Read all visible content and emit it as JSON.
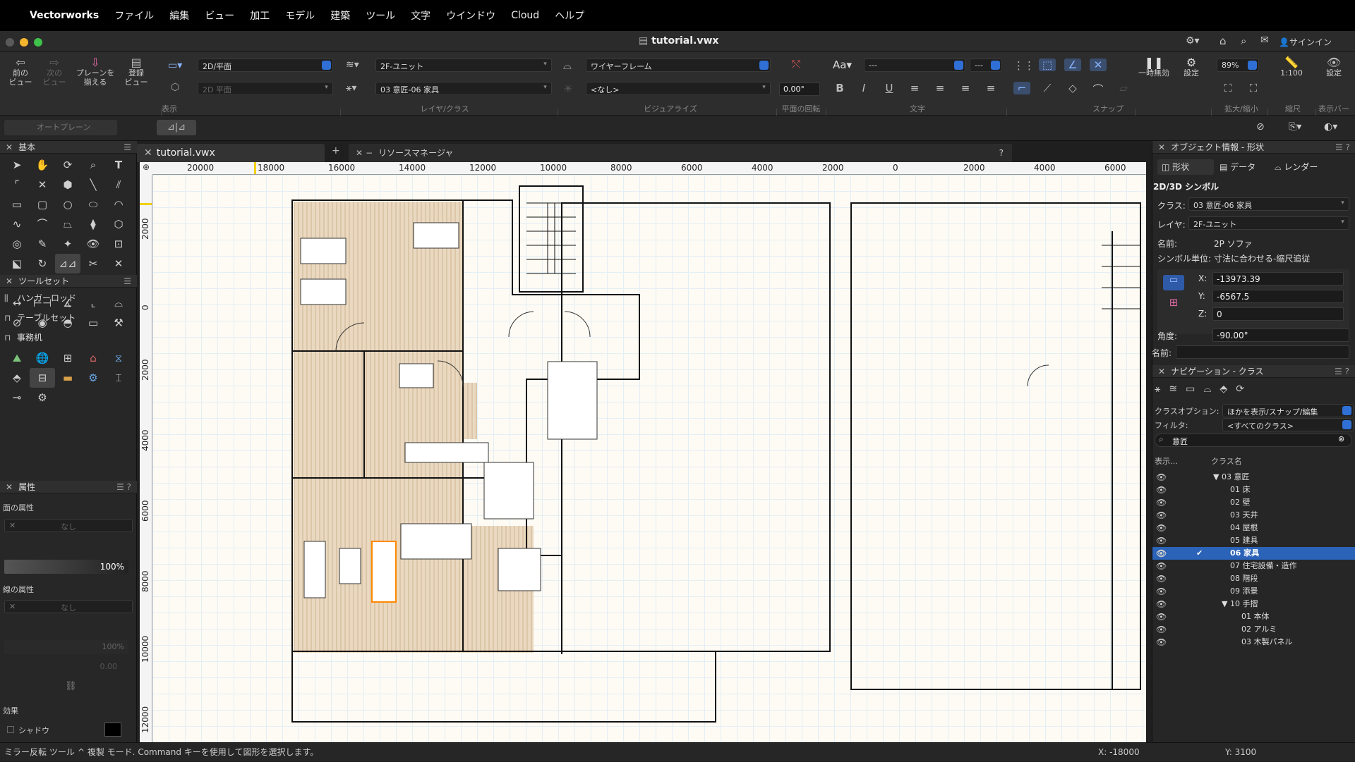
{
  "menubar": {
    "app": "Vectorworks",
    "items": [
      "ファイル",
      "編集",
      "ビュー",
      "加工",
      "モデル",
      "建築",
      "ツール",
      "文字",
      "ウインドウ",
      "Cloud",
      "ヘルプ"
    ]
  },
  "window": {
    "title": "tutorial.vwx",
    "signin": "サインイン"
  },
  "toolbar": {
    "prev_view": "前の\nビュー",
    "next_view": "次の\nビュー",
    "align_plane": "プレーンを\n揃える",
    "register_view": "登録\nビュー",
    "view_dropdown": "2D/平面",
    "plane_dropdown": "2D 平面",
    "layer_dropdown": "2F-ユニット",
    "class_dropdown": "03 意匠-06 家具",
    "render_dropdown": "ワイヤーフレーム",
    "light_dropdown": "<なし>",
    "rotation_value": "0.00°",
    "font_dropdown": "---",
    "size_dropdown": "---",
    "pause": "一時無効",
    "settings": "設定",
    "zoom_value": "89%",
    "scale_value": "1:100",
    "settings2": "設定",
    "group_view": "表示",
    "group_layer": "レイヤ/クラス",
    "group_visual": "ビジュアライズ",
    "group_rotation": "平面の回転",
    "group_text": "文字",
    "group_snap": "スナップ",
    "group_zoom": "拡大/縮小",
    "group_scale": "縮尺",
    "group_viewbar": "表示バー"
  },
  "modebar": {
    "autoplane": "オートプレーン"
  },
  "left": {
    "basic_title": "基本",
    "toolset_title": "ツールセット",
    "toolset_items": [
      "ハンガーロッド",
      "テーブルセット",
      "事務机"
    ],
    "attr_title": "属性",
    "fill_label": "面の属性",
    "fill_value": "なし",
    "opacity": "100%",
    "line_label": "線の属性",
    "line_value": "なし",
    "line_opacity": "100%",
    "line_weight": "0.00",
    "effect_label": "効果",
    "shadow_label": "シャドウ"
  },
  "doc": {
    "tab1": "tutorial.vwx",
    "tab2": "リソースマネージャ",
    "help": "?",
    "ruler_h": [
      "20000",
      "18000",
      "16000",
      "14000",
      "12000",
      "10000",
      "8000",
      "6000",
      "4000",
      "2000",
      "0",
      "2000",
      "4000",
      "6000"
    ],
    "ruler_v": [
      "2000",
      "0",
      "2000",
      "4000",
      "6000",
      "8000",
      "10000",
      "12000"
    ]
  },
  "objinfo": {
    "title": "オブジェクト情報 - 形状",
    "tabs": [
      "形状",
      "データ",
      "レンダー"
    ],
    "type": "2D/3D シンボル",
    "class_label": "クラス:",
    "class_value": "03 意匠-06 家具",
    "layer_label": "レイヤ:",
    "layer_value": "2F-ユニット",
    "name_label": "名前:",
    "name_value": "2P ソファ",
    "unit_label": "シンボル単位:",
    "unit_value": "寸法に合わせる-縮尺追従",
    "x_label": "X:",
    "x_value": "-13973.39",
    "y_label": "Y:",
    "y_value": "-6567.5",
    "z_label": "Z:",
    "z_value": "0",
    "angle_label": "角度:",
    "angle_value": "-90.00°",
    "name2_label": "名前:"
  },
  "nav": {
    "title": "ナビゲーション - クラス",
    "option_label": "クラスオプション:",
    "option_value": "ほかを表示/スナップ/編集",
    "filter_label": "フィルタ:",
    "filter_value": "<すべてのクラス>",
    "search_value": "意匠",
    "col_display": "表示…",
    "col_name": "クラス名",
    "classes": [
      "▼ 03 意匠",
      "01 床",
      "02 壁",
      "03 天井",
      "04 屋根",
      "05 建具",
      "06 家具",
      "07 住宅設備・造作",
      "08 階段",
      "09 添景",
      "▼ 10 手摺",
      "01 本体",
      "02 アルミ",
      "03 木製パネル"
    ],
    "selected_index": 6
  },
  "status": {
    "tool": "ミラー反転 ツール",
    "message": "^  複製 モード. Command キーを使用して図形を選択します。",
    "x": "X: -18000",
    "y": "Y: 3100"
  },
  "colors": {
    "accent": "#2f6fd6",
    "selection": "#2b63b8",
    "floor": "#ead9c0",
    "highlight": "#ff8800"
  }
}
